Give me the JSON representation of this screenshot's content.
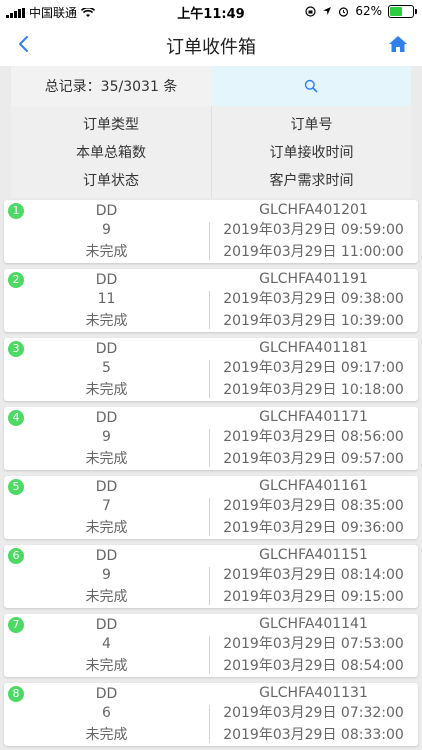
{
  "status_bar": {
    "carrier": "中国联通",
    "time": "上午11:49",
    "battery": "62%",
    "battery_level": 0.62
  },
  "nav": {
    "title": "订单收件箱"
  },
  "summary": {
    "total_label": "总记录：35/3031 条"
  },
  "headers": {
    "left": [
      "订单类型",
      "本单总箱数",
      "订单状态"
    ],
    "right": [
      "订单号",
      "订单接收时间",
      "客户需求时间"
    ]
  },
  "orders": [
    {
      "index": "1",
      "type": "DD",
      "boxes": "9",
      "status": "未完成",
      "order_no": "GLCHFA401201",
      "received": "2019年03月29日 09:59:00",
      "required": "2019年03月29日 11:00:00"
    },
    {
      "index": "2",
      "type": "DD",
      "boxes": "11",
      "status": "未完成",
      "order_no": "GLCHFA401191",
      "received": "2019年03月29日 09:38:00",
      "required": "2019年03月29日 10:39:00"
    },
    {
      "index": "3",
      "type": "DD",
      "boxes": "5",
      "status": "未完成",
      "order_no": "GLCHFA401181",
      "received": "2019年03月29日 09:17:00",
      "required": "2019年03月29日 10:18:00"
    },
    {
      "index": "4",
      "type": "DD",
      "boxes": "9",
      "status": "未完成",
      "order_no": "GLCHFA401171",
      "received": "2019年03月29日 08:56:00",
      "required": "2019年03月29日 09:57:00"
    },
    {
      "index": "5",
      "type": "DD",
      "boxes": "7",
      "status": "未完成",
      "order_no": "GLCHFA401161",
      "received": "2019年03月29日 08:35:00",
      "required": "2019年03月29日 09:36:00"
    },
    {
      "index": "6",
      "type": "DD",
      "boxes": "9",
      "status": "未完成",
      "order_no": "GLCHFA401151",
      "received": "2019年03月29日 08:14:00",
      "required": "2019年03月29日 09:15:00"
    },
    {
      "index": "7",
      "type": "DD",
      "boxes": "4",
      "status": "未完成",
      "order_no": "GLCHFA401141",
      "received": "2019年03月29日 07:53:00",
      "required": "2019年03月29日 08:54:00"
    },
    {
      "index": "8",
      "type": "DD",
      "boxes": "6",
      "status": "未完成",
      "order_no": "GLCHFA401131",
      "received": "2019年03月29日 07:32:00",
      "required": "2019年03月29日 08:33:00"
    }
  ],
  "colors": {
    "accent": "#2f80ed",
    "badge": "#4cd964",
    "search_bg": "#e4f5fb"
  }
}
